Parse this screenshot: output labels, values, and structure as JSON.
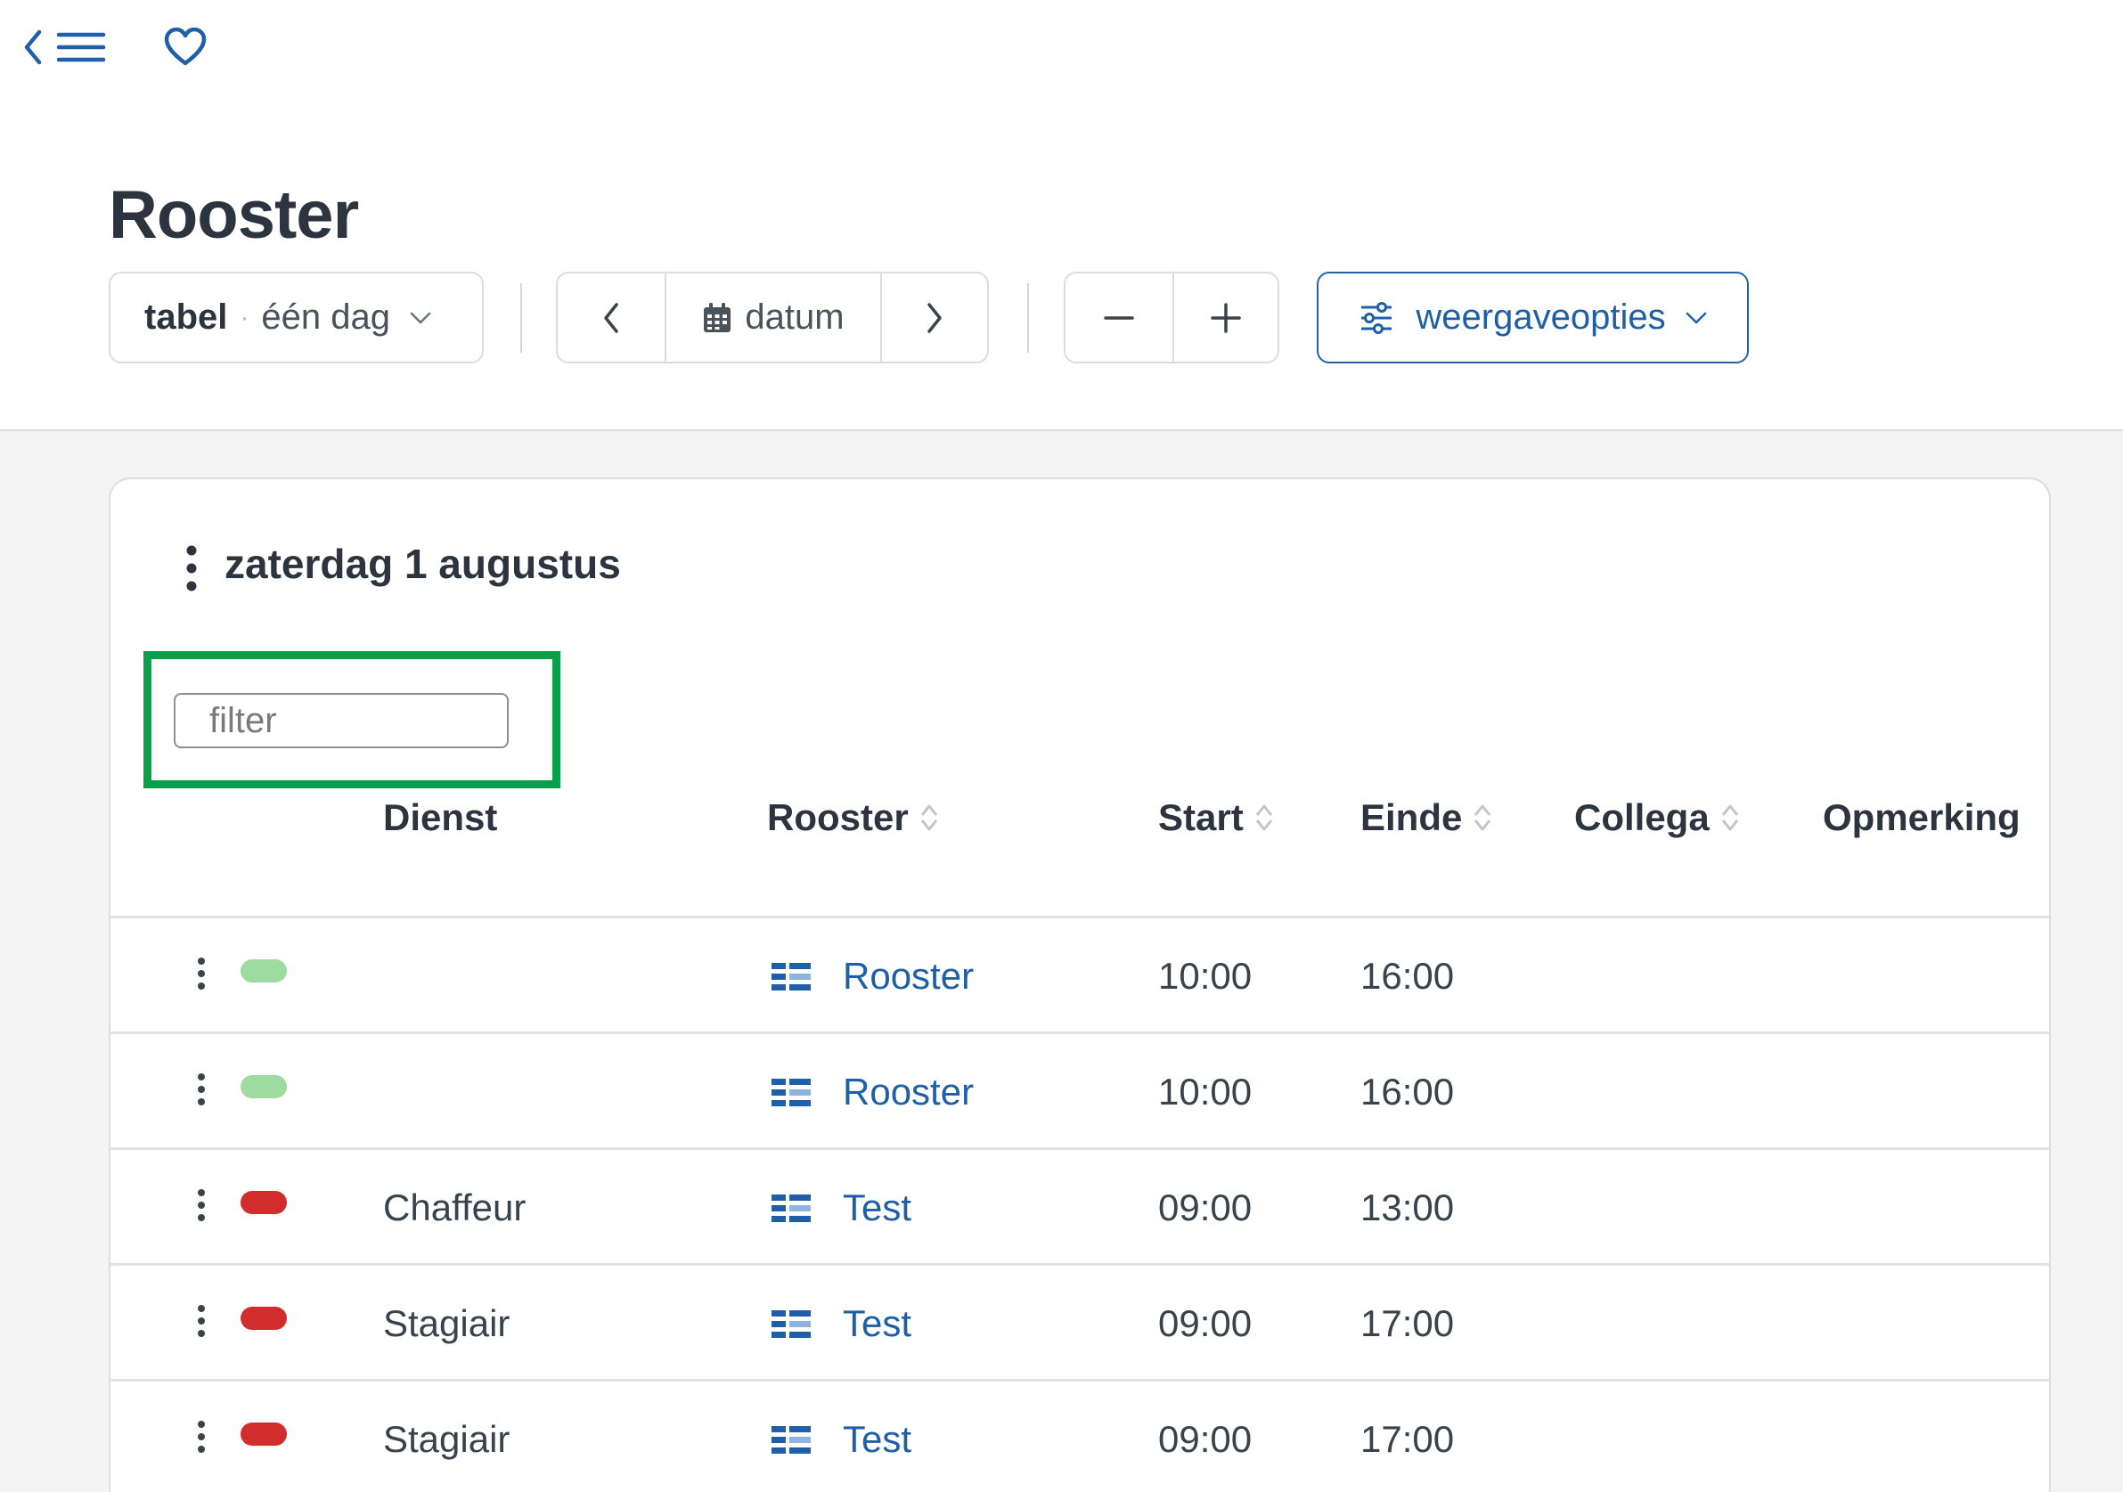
{
  "page": {
    "title": "Rooster"
  },
  "toolbar": {
    "view_mode": "tabel",
    "view_separator": "·",
    "view_range": "één dag",
    "date_label": "datum",
    "options_label": "weergaveopties"
  },
  "colors": {
    "accent": "#1f5fa8",
    "highlight": "#08a04a",
    "pill_green": "#9edb9e",
    "pill_red": "#d12d2d"
  },
  "day": {
    "title": "zaterdag 1 augustus",
    "filter_placeholder": "filter",
    "columns": {
      "dienst": "Dienst",
      "rooster": "Rooster",
      "start": "Start",
      "einde": "Einde",
      "collega": "Collega",
      "opmerking": "Opmerking"
    },
    "rows": [
      {
        "status": "green",
        "dienst": "",
        "rooster": "Rooster",
        "start": "10:00",
        "einde": "16:00",
        "collega": "",
        "opmerking": ""
      },
      {
        "status": "green",
        "dienst": "",
        "rooster": "Rooster",
        "start": "10:00",
        "einde": "16:00",
        "collega": "",
        "opmerking": ""
      },
      {
        "status": "red",
        "dienst": "Chaffeur",
        "rooster": "Test",
        "start": "09:00",
        "einde": "13:00",
        "collega": "",
        "opmerking": ""
      },
      {
        "status": "red",
        "dienst": "Stagiair",
        "rooster": "Test",
        "start": "09:00",
        "einde": "17:00",
        "collega": "",
        "opmerking": ""
      },
      {
        "status": "red",
        "dienst": "Stagiair",
        "rooster": "Test",
        "start": "09:00",
        "einde": "17:00",
        "collega": "",
        "opmerking": ""
      }
    ]
  }
}
